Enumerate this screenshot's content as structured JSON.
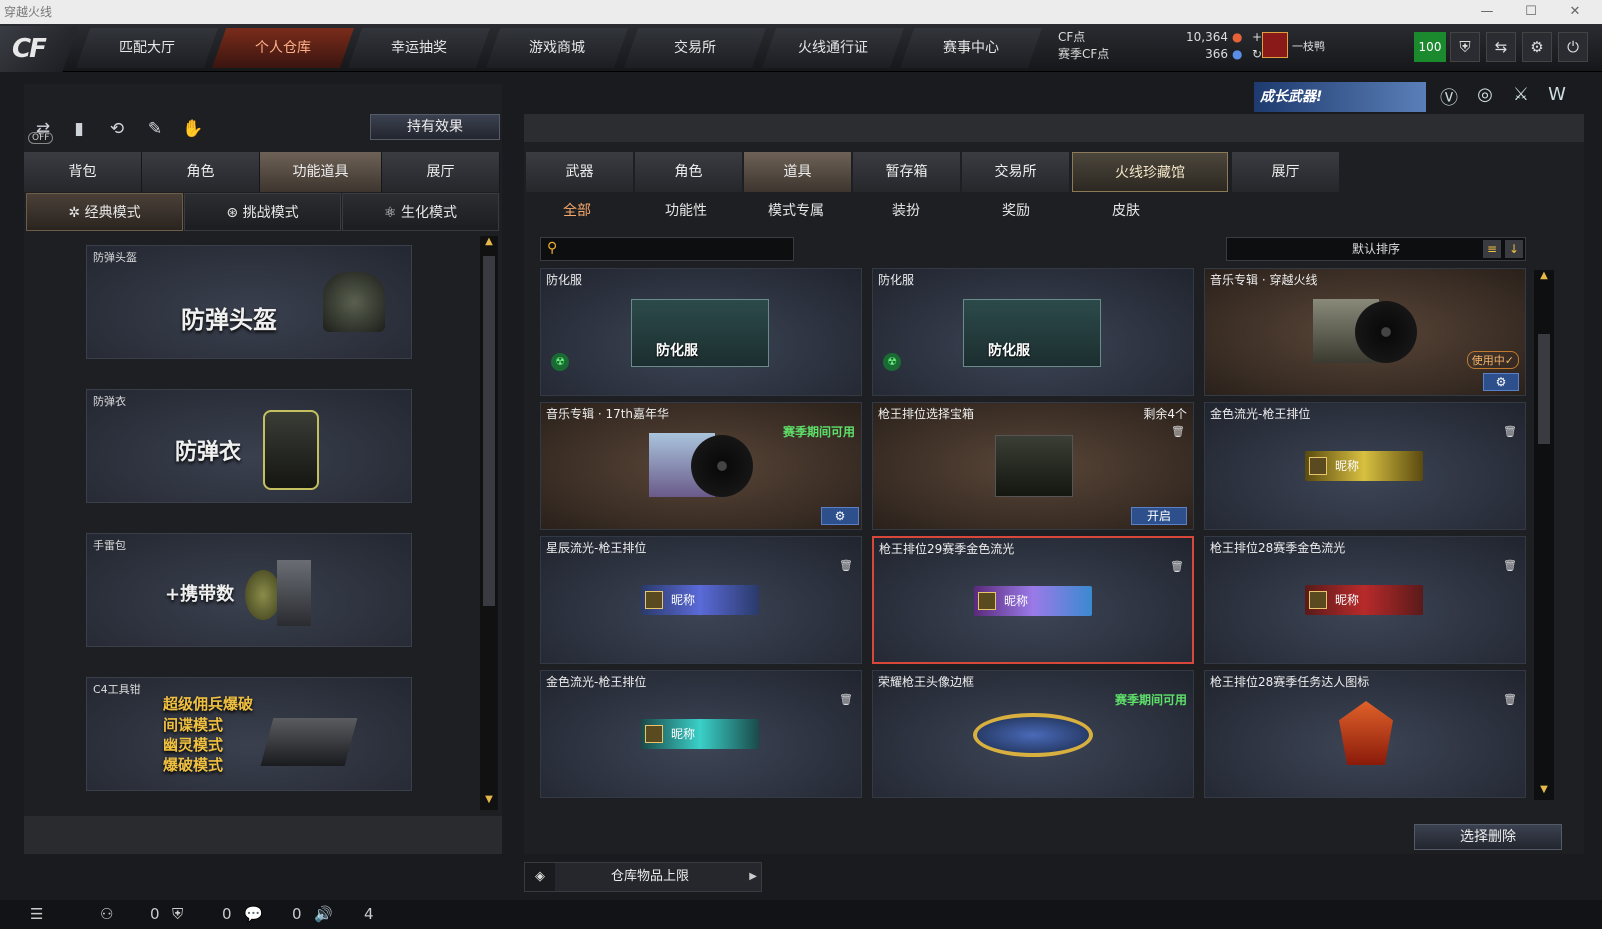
{
  "window": {
    "title": "穿越火线",
    "min": "—",
    "max": "☐",
    "close": "✕"
  },
  "nav": {
    "logo": "CF",
    "tabs": [
      "匹配大厅",
      "个人仓库",
      "幸运抽奖",
      "游戏商城",
      "交易所",
      "火线通行证",
      "赛事中心"
    ],
    "active": "个人仓库"
  },
  "currency": {
    "cf_label": "CF点",
    "cf_value": "10,364",
    "season_label": "赛季CF点",
    "season_value": "366",
    "plus": "+",
    "refresh": "↻"
  },
  "user": {
    "rank": "一枝鸭",
    "level": "100"
  },
  "top_icons": [
    "shield-icon",
    "exit-icon",
    "gear-icon",
    "power-icon"
  ],
  "banner": {
    "text": "成长武器!"
  },
  "left": {
    "effects_button": "持有效果",
    "off_label": "OFF",
    "tabs": [
      "背包",
      "角色",
      "功能道具",
      "展厅"
    ],
    "active_tab": "功能道具",
    "modes": [
      "经典模式",
      "挑战模式",
      "生化模式"
    ],
    "active_mode": "经典模式",
    "items": [
      {
        "label": "防弹头盔",
        "art": "防弹头盔"
      },
      {
        "label": "防弹衣",
        "art": "防弹衣"
      },
      {
        "label": "手雷包",
        "art": "+携带数"
      },
      {
        "label": "C4工具钳",
        "art": [
          "超级佣兵爆破",
          "间谍模式",
          "幽灵模式",
          "爆破模式"
        ]
      }
    ]
  },
  "right": {
    "tabs": [
      "武器",
      "角色",
      "道具",
      "暂存箱",
      "交易所",
      "火线珍藏馆",
      "展厅"
    ],
    "active_tab": "道具",
    "subtabs": [
      "全部",
      "功能性",
      "模式专属",
      "装扮",
      "奖励",
      "皮肤"
    ],
    "active_subtab": "全部",
    "sort": "默认排序",
    "delete_button": "选择删除",
    "capacity_label": "仓库物品上限",
    "cards": [
      {
        "title": "防化服",
        "art": "防化服"
      },
      {
        "title": "防化服",
        "art": "防化服"
      },
      {
        "title": "音乐专辑 · 穿越火线",
        "inuse": "使用中✓"
      },
      {
        "title": "音乐专辑 · 17th嘉年华",
        "tag": "赛季期间可用"
      },
      {
        "title": "枪王排位选择宝箱",
        "remain": "剩余4个",
        "open": "开启"
      },
      {
        "title": "金色流光-枪王排位",
        "nickname": "昵称"
      },
      {
        "title": "星辰流光-枪王排位",
        "nickname": "昵称"
      },
      {
        "title": "枪王排位29赛季金色流光",
        "nickname": "昵称"
      },
      {
        "title": "枪王排位28赛季金色流光",
        "nickname": "昵称"
      },
      {
        "title": "金色流光-枪王排位",
        "nickname": "昵称"
      },
      {
        "title": "荣耀枪王头像边框",
        "tag": "赛季期间可用"
      },
      {
        "title": "枪王排位28赛季任务达人图标"
      }
    ]
  },
  "bottom": {
    "c1": "0",
    "c2": "0",
    "c3": "0",
    "c4": "4"
  },
  "colors": {
    "accent": "#f6a86b",
    "green": "#5ee06a",
    "selected": "#d8483a"
  }
}
